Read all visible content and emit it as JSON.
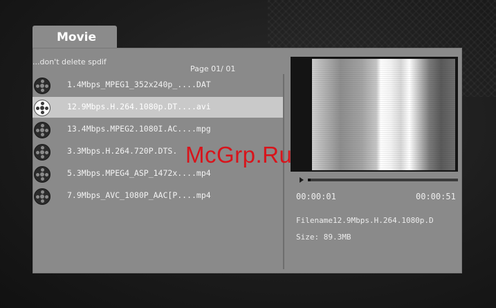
{
  "tab": {
    "title": "Movie"
  },
  "path_label": "...don't delete spdif",
  "page_label": "Page  01/ 01",
  "files": [
    {
      "name": "1.4Mbps_MPEG1_352x240p_....DAT",
      "icon": "film-reel-icon",
      "selected": false
    },
    {
      "name": "12.9Mbps.H.264.1080p.DT....avi",
      "icon": "film-reel-icon",
      "selected": true
    },
    {
      "name": "13.4Mbps.MPEG2.1080I.AC....mpg",
      "icon": "film-reel-icon",
      "selected": false
    },
    {
      "name": "3.3Mbps.H.264.720P.DTS.",
      "icon": "film-reel-icon",
      "selected": false
    },
    {
      "name": "5.3Mbps.MPEG4_ASP_1472x....mp4",
      "icon": "film-reel-icon",
      "selected": false
    },
    {
      "name": "7.9Mbps_AVC_1080P_AAC[P....mp4",
      "icon": "film-reel-icon",
      "selected": false
    }
  ],
  "player": {
    "play_icon": "play-icon",
    "progress": 0.02,
    "elapsed": "00:00:01",
    "total": "00:00:51"
  },
  "info": {
    "filename": "Filename12.9Mbps.H.264.1080p.D",
    "size": "Size:  89.3MB"
  },
  "watermark": "McGrp.Ru",
  "colors": {
    "panel": "#8a8a8a",
    "selection": "#c9c9c9",
    "watermark": "#d8141b"
  }
}
